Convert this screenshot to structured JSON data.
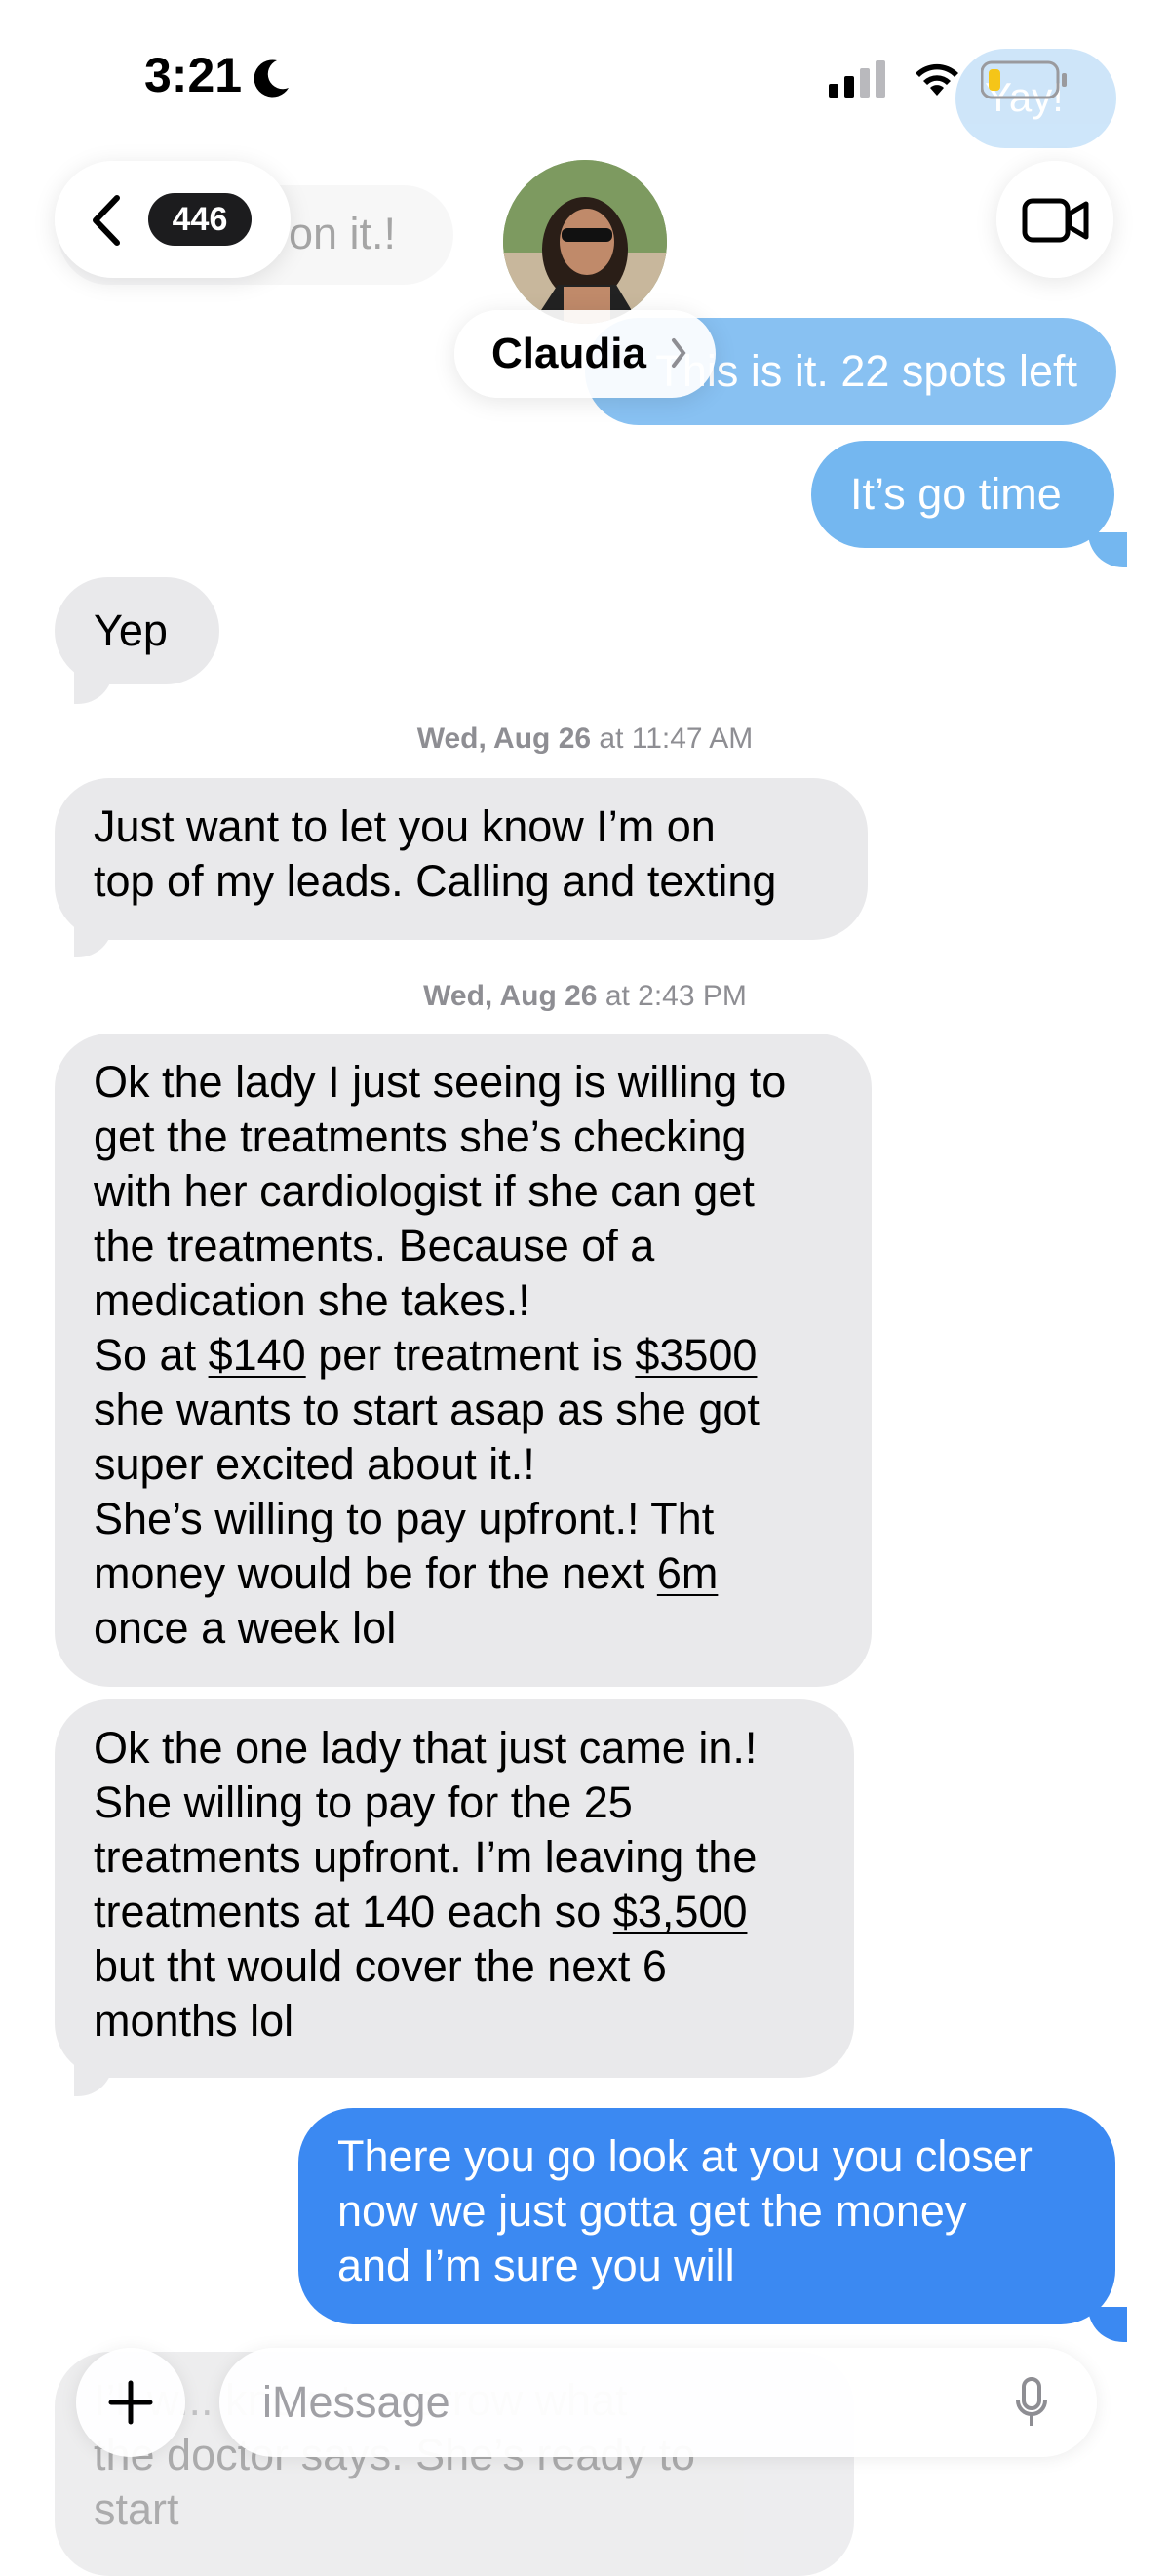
{
  "status": {
    "time": "3:21"
  },
  "header": {
    "back_count": "446",
    "contact_name": "Claudia"
  },
  "faded": {
    "yay": "Yay!",
    "on_it": "on it.!",
    "spots_left": "This is it. 22 spots left"
  },
  "messages": {
    "go_time": "It’s go time",
    "yep": "Yep",
    "ts1": {
      "day": "Wed, Aug 26",
      "time": "at 11:47 AM"
    },
    "leads": [
      "Just want to let you know I’m on",
      "top of my leads. Calling and texting"
    ],
    "ts2": {
      "day": "Wed, Aug 26",
      "time": "at 2:43 PM"
    },
    "m3": {
      "l1": "Ok the lady I just seeing is willing to",
      "l2": "get the treatments she’s checking",
      "l3": "with her cardiologist if she can get",
      "l4": "the treatments. Because of a",
      "l5": "medication she takes.!",
      "l6a": "So at ",
      "l6b": "$140",
      "l6c": " per treatment is ",
      "l6d": "$3500",
      "l7": "she wants to start asap as she got",
      "l8": "super excited about it.!",
      "l9": "She’s willing to pay upfront.! Tht",
      "l10a": "money would be for the next ",
      "l10b": "6m",
      "l11": "once a week lol"
    },
    "m4": {
      "l1": "Ok the one lady that just came in.!",
      "l2": "She willing to pay for the 25",
      "l3": "treatments upfront. I’m leaving the",
      "l4a": "treatments at 140 each so ",
      "l4b": "$3,500",
      "l5": "but tht would cover the next 6",
      "l6": "months lol"
    },
    "m5": [
      "There you go look at you you closer",
      "now we just gotta get the money",
      "and I’m sure you will"
    ],
    "m6_partial": [
      "I’ll w... know tomorrow what",
      "the doctor says. She’s ready to",
      "start"
    ]
  },
  "input": {
    "placeholder": "iMessage"
  },
  "colors": {
    "incoming": "#e9e9eb",
    "outgoing_light": "#74b7f0",
    "outgoing_blue": "#3b89f2",
    "battery_low": "#f5c518"
  }
}
